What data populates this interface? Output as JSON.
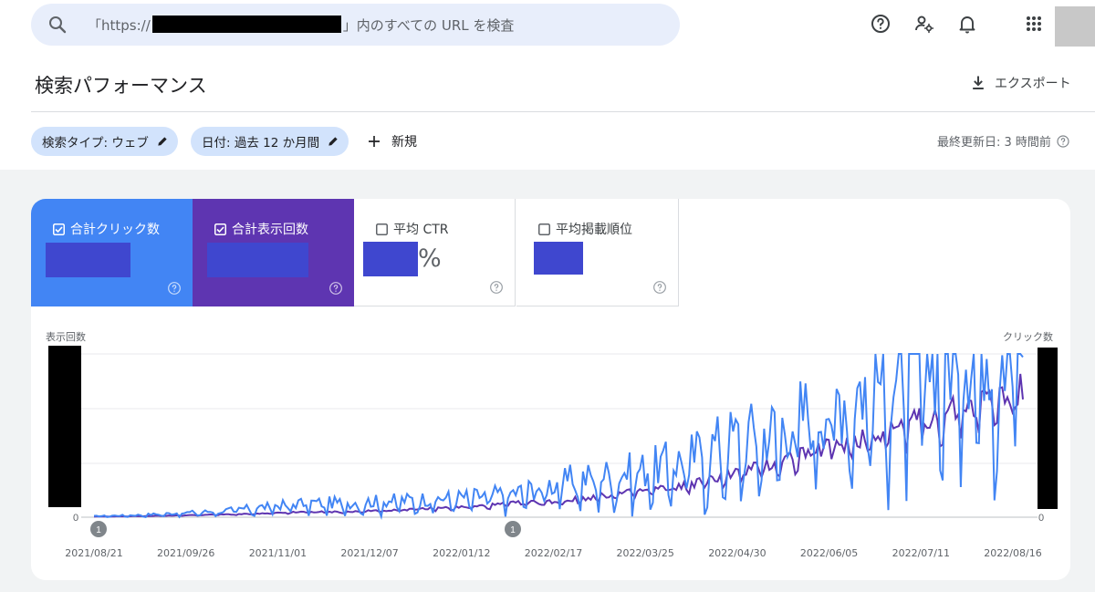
{
  "search": {
    "prefix": "「https://",
    "suffix": "」内のすべての URL を検査"
  },
  "header": {
    "title": "検索パフォーマンス",
    "export_label": "エクスポート"
  },
  "filters": {
    "search_type": "検索タイプ: ウェブ",
    "date": "日付: 過去 12 か月間",
    "new_label": "新規",
    "last_updated": "最終更新日: 3 時間前"
  },
  "metrics": [
    {
      "label": "合計クリック数",
      "checked": true,
      "color": "#4285f4"
    },
    {
      "label": "合計表示回数",
      "checked": true,
      "color": "#5e35b1"
    },
    {
      "label": "平均 CTR",
      "checked": false,
      "unit": "%"
    },
    {
      "label": "平均掲載順位",
      "checked": false
    }
  ],
  "colors": {
    "clicks": "#4285f4",
    "impressions": "#5e35b1",
    "redaction": "#3f47cf"
  },
  "chart_data": {
    "type": "line",
    "left_axis_label": "表示回数",
    "right_axis_label": "クリック数",
    "y_left_zero": "0",
    "y_right_zero": "0",
    "x_ticks": [
      "2021/08/21",
      "2021/09/26",
      "2021/11/01",
      "2021/12/07",
      "2022/01/12",
      "2022/02/17",
      "2022/03/25",
      "2022/04/30",
      "2022/06/05",
      "2022/07/11",
      "2022/08/16"
    ],
    "annotations": [
      {
        "date": "2021/08/21",
        "label": "1"
      },
      {
        "date": "2022/01/20",
        "label": "1"
      }
    ],
    "series": [
      {
        "name": "合計クリック数",
        "color": "#4285f4",
        "values": [
          0.5,
          1,
          2,
          3,
          5,
          7,
          7,
          8,
          9,
          10,
          12,
          17,
          20,
          23,
          28,
          38,
          42,
          52,
          62,
          72,
          82,
          88,
          100
        ]
      },
      {
        "name": "合計表示回数",
        "color": "#5e35b1",
        "values": [
          0.3,
          0.6,
          1,
          1.5,
          2,
          3,
          3,
          4,
          5,
          6,
          8,
          9,
          12,
          15,
          18,
          24,
          30,
          38,
          44,
          52,
          58,
          66,
          72
        ]
      }
    ]
  }
}
